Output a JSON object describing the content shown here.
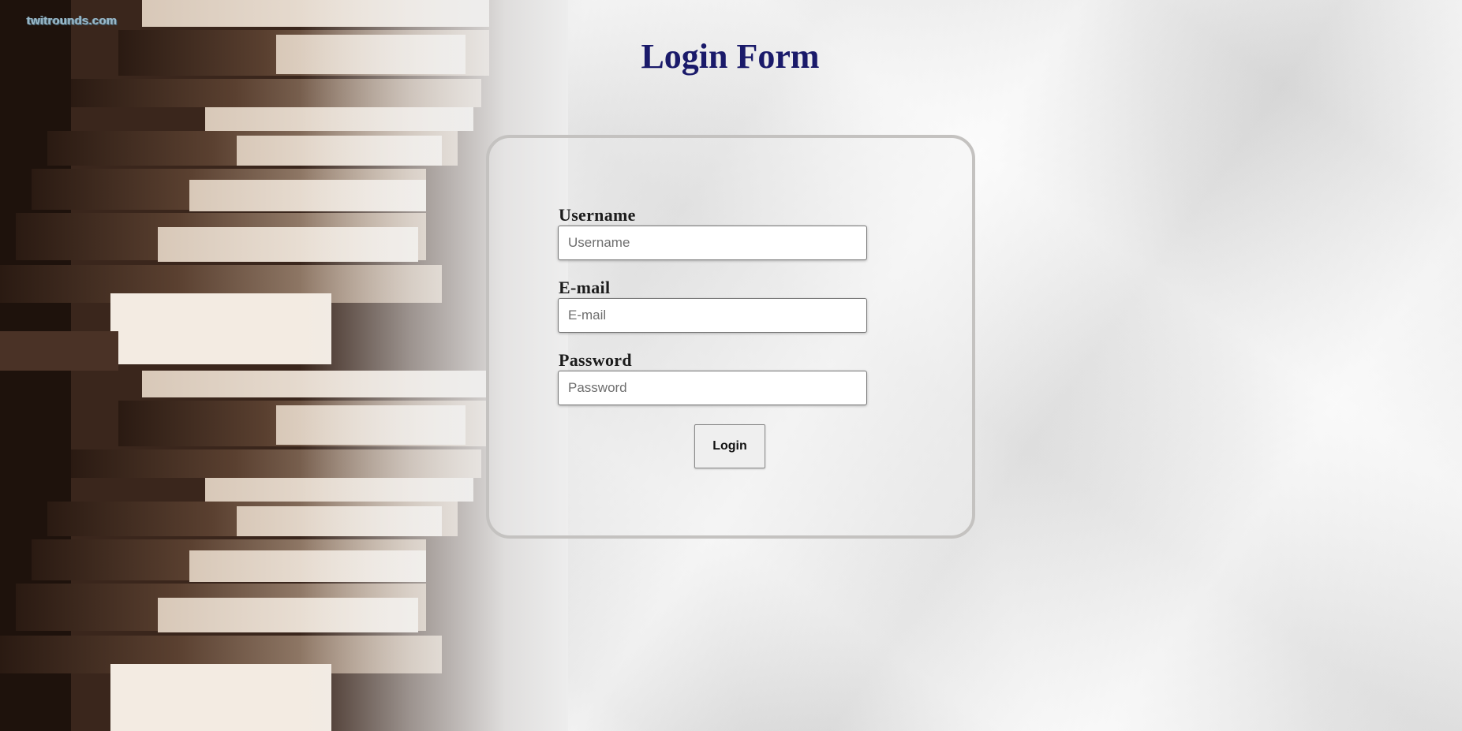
{
  "watermark": "twitrounds.com",
  "page": {
    "title": "Login Form"
  },
  "form": {
    "username": {
      "label": "Username",
      "placeholder": "Username",
      "value": ""
    },
    "email": {
      "label": "E-mail",
      "placeholder": "E-mail",
      "value": ""
    },
    "password": {
      "label": "Password",
      "placeholder": "Password",
      "value": ""
    },
    "submit_label": "Login"
  },
  "colors": {
    "title": "#1a1a6a",
    "panel_border": "#c4c2c0",
    "background": "#ededed"
  }
}
